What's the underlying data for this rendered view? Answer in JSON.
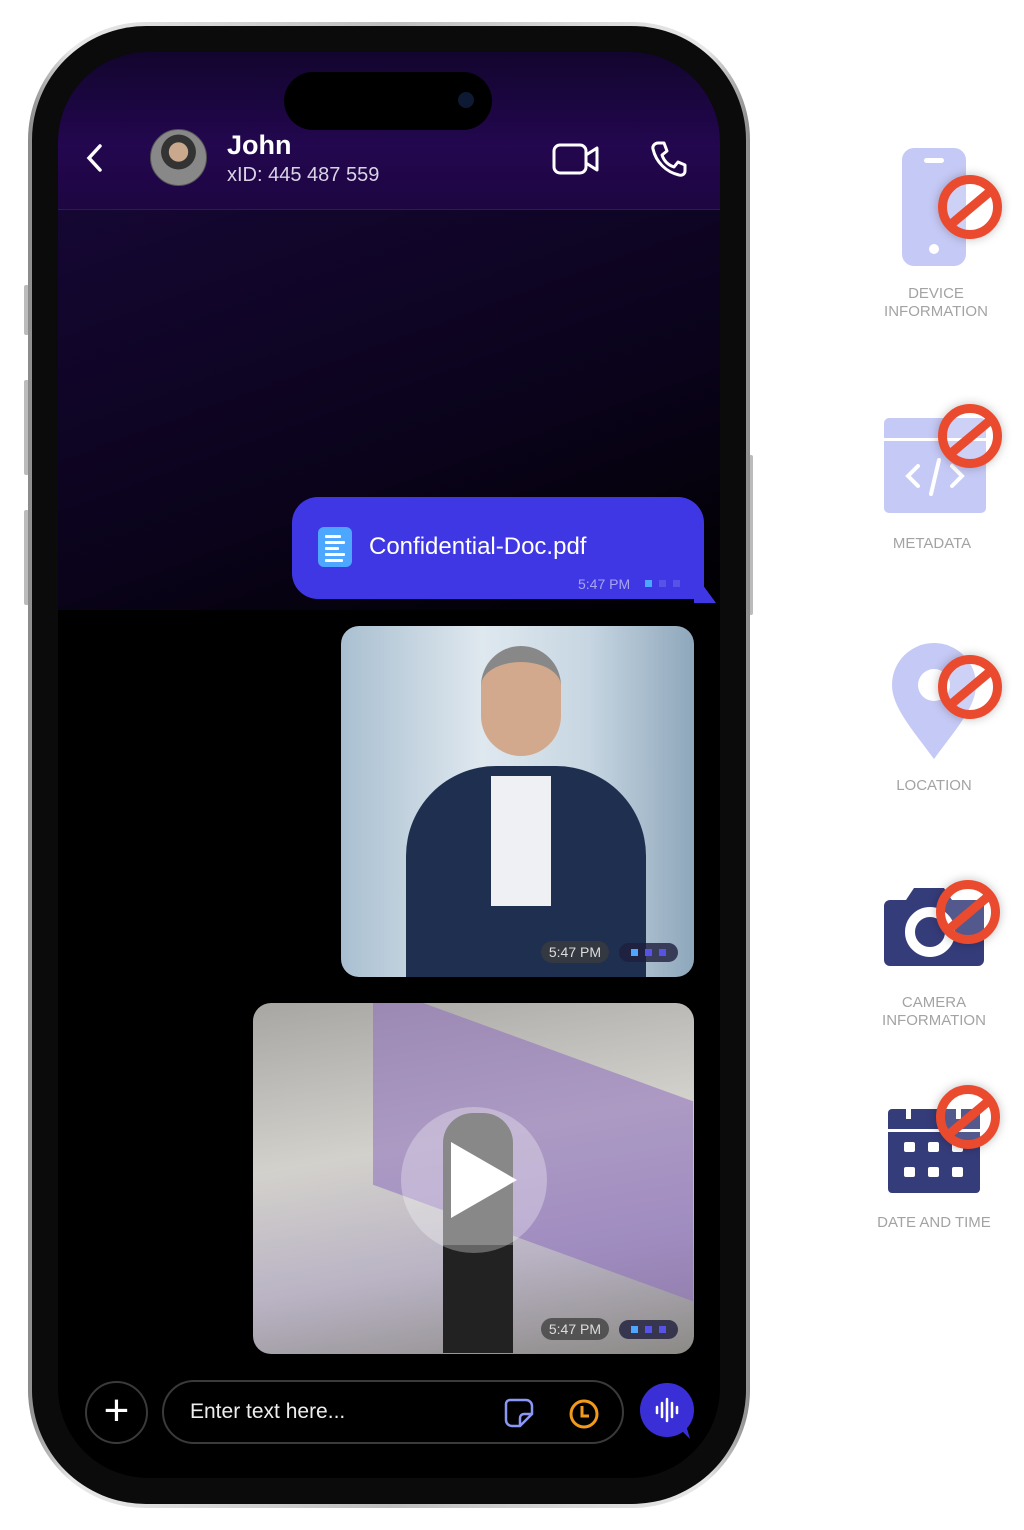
{
  "chat": {
    "contact_name": "John",
    "contact_id": "xID: 445 487 559",
    "messages": [
      {
        "type": "file",
        "filename": "Confidential-Doc.pdf",
        "time": "5:47 PM"
      },
      {
        "type": "image",
        "time": "5:47 PM"
      },
      {
        "type": "video",
        "time": "5:47 PM"
      }
    ]
  },
  "composer": {
    "placeholder": "Enter text here..."
  },
  "colors": {
    "accent": "#3f37e4",
    "header": "#23074f",
    "ban": "#ea4a2e",
    "icon_light": "#c5c9f5",
    "icon_dark": "#353c7a"
  },
  "features": [
    {
      "label_lines": [
        "DEVICE",
        "INFORMATION"
      ],
      "icon": "phone-icon"
    },
    {
      "label_lines": [
        "METADATA"
      ],
      "icon": "code-icon"
    },
    {
      "label_lines": [
        "LOCATION"
      ],
      "icon": "location-pin-icon"
    },
    {
      "label_lines": [
        "CAMERA",
        "INFORMATION"
      ],
      "icon": "camera-icon"
    },
    {
      "label_lines": [
        "DATE AND TIME"
      ],
      "icon": "calendar-icon"
    }
  ]
}
